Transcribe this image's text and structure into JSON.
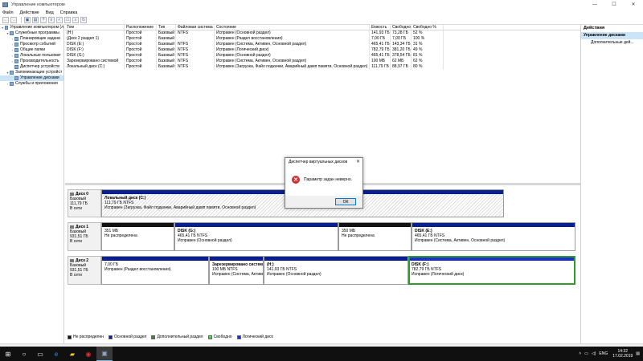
{
  "window": {
    "title": "Управление компьютером"
  },
  "menu": [
    "Файл",
    "Действие",
    "Вид",
    "Справка"
  ],
  "tree": [
    {
      "label": "Управление компьютером (л",
      "level": 0,
      "twisty": "▾"
    },
    {
      "label": "Служебные программы",
      "level": 1,
      "twisty": "▾"
    },
    {
      "label": "Планировщик задани",
      "level": 2,
      "twisty": "›"
    },
    {
      "label": "Просмотр событий",
      "level": 2,
      "twisty": "›"
    },
    {
      "label": "Общие папки",
      "level": 2,
      "twisty": "›"
    },
    {
      "label": "Локальные пользоват",
      "level": 2,
      "twisty": "›"
    },
    {
      "label": "Производительность",
      "level": 2,
      "twisty": "›"
    },
    {
      "label": "Диспетчер устройств",
      "level": 2,
      "twisty": ""
    },
    {
      "label": "Запоминающие устройст",
      "level": 1,
      "twisty": "▾"
    },
    {
      "label": "Управление дисками",
      "level": 2,
      "twisty": "",
      "selected": true
    },
    {
      "label": "Службы и приложения",
      "level": 1,
      "twisty": "›"
    }
  ],
  "volume_table": {
    "headers": [
      "Том",
      "Расположение",
      "Тип",
      "Файловая система",
      "Состояние",
      "Емкость",
      "Свободно",
      "Свободно %"
    ],
    "rows": [
      [
        "(H:)",
        "Простой",
        "Базовый",
        "NTFS",
        "Исправен (Основной раздел)",
        "141,93 ГБ",
        "73,28 ГБ",
        "52 %"
      ],
      [
        "(Диск 2 раздел 1)",
        "Простой",
        "Базовый",
        "",
        "Исправен (Раздел восстановления)",
        "7,00 ГБ",
        "7,00 ГБ",
        "100 %"
      ],
      [
        "DISK (E:)",
        "Простой",
        "Базовый",
        "NTFS",
        "Исправен (Система, Активен, Основной раздел)",
        "465,41 ГБ",
        "143,34 ГБ",
        "31 %"
      ],
      [
        "DISK (F:)",
        "Простой",
        "Базовый",
        "NTFS",
        "Исправен (Логический диск)",
        "782,79 ГБ",
        "381,20 ГБ",
        "49 %"
      ],
      [
        "DISK (G:)",
        "Простой",
        "Базовый",
        "NTFS",
        "Исправен (Основной раздел)",
        "465,41 ГБ",
        "378,54 ГБ",
        "81 %"
      ],
      [
        "Зарезервировано системой",
        "Простой",
        "Базовый",
        "NTFS",
        "Исправен (Система, Активен, Основной раздел)",
        "100 МБ",
        "62 МБ",
        "62 %"
      ],
      [
        "Локальный диск (C:)",
        "Простой",
        "Базовый",
        "NTFS",
        "Исправен (Загрузка, Файл подкачки, Аварийный дамп памяти, Основной раздел)",
        "111,79 ГБ",
        "88,97 ГБ",
        "80 %"
      ]
    ]
  },
  "disks": [
    {
      "name": "Диск 0",
      "type": "Базовый",
      "size": "111,79 ГБ",
      "status": "В сети",
      "partitions": [
        {
          "title": "Локальный диск (C:)",
          "line2": "111,79 ГБ NTFS",
          "line3": "Исправен (Загрузка, Файл подкачки, Аварийный дамп памяти, Основной раздел)",
          "color": "#0a1f8f",
          "hatched": true
        }
      ]
    },
    {
      "name": "Диск 1",
      "type": "Базовый",
      "size": "931,51 ГБ",
      "status": "В сети",
      "partitions": [
        {
          "title": "",
          "line2": "351 МБ",
          "line3": "Не распределена",
          "color": "#111111"
        },
        {
          "title": "DISK (G:)",
          "line2": "465,41 ГБ NTFS",
          "line3": "Исправен (Основной раздел)",
          "color": "#0a1f8f"
        },
        {
          "title": "",
          "line2": "350 МБ",
          "line3": "Не распределена",
          "color": "#111111"
        },
        {
          "title": "DISK (E:)",
          "line2": "465,41 ГБ NTFS",
          "line3": "Исправен (Система, Активен, Основной раздел)",
          "color": "#0a1f8f"
        }
      ]
    },
    {
      "name": "Диск 2",
      "type": "Базовый",
      "size": "931,51 ГБ",
      "status": "В сети",
      "partitions": [
        {
          "title": "",
          "line2": "7,00 ГБ",
          "line3": "Исправен (Раздел восстановления)",
          "color": "#0a1f8f"
        },
        {
          "title": "Зарезервировано системо",
          "line2": "100 МБ NTFS",
          "line3": "Исправен (Система, Активен, Основ",
          "color": "#0a1f8f"
        },
        {
          "title": "(H:)",
          "line2": "141,93 ГБ NTFS",
          "line3": "Исправен (Основной раздел)",
          "color": "#0a1f8f"
        },
        {
          "title": "DISK (F:)",
          "line2": "782,79 ГБ NTFS",
          "line3": "Исправен (Логический диск)",
          "color": "#1a2fd0",
          "selected": true
        }
      ]
    }
  ],
  "legend": [
    {
      "label": "Не распределен",
      "color": "#111111"
    },
    {
      "label": "Основной раздел",
      "color": "#0a1f8f"
    },
    {
      "label": "Дополнительный раздел",
      "color": "#2f8f2f"
    },
    {
      "label": "Свободно",
      "color": "#4fd24f"
    },
    {
      "label": "Логический диск",
      "color": "#1a2fd0"
    }
  ],
  "actions": {
    "title": "Действия",
    "section": "Управление дисками",
    "item": "Дополнительные дей..."
  },
  "dialog": {
    "title": "Диспетчер виртуальных дисков",
    "message": "Параметр задан неверно.",
    "ok": "ОК",
    "close": "✕"
  },
  "taskbar": {
    "lang": "ENG",
    "time": "14:32",
    "date": "17.02.2019"
  }
}
